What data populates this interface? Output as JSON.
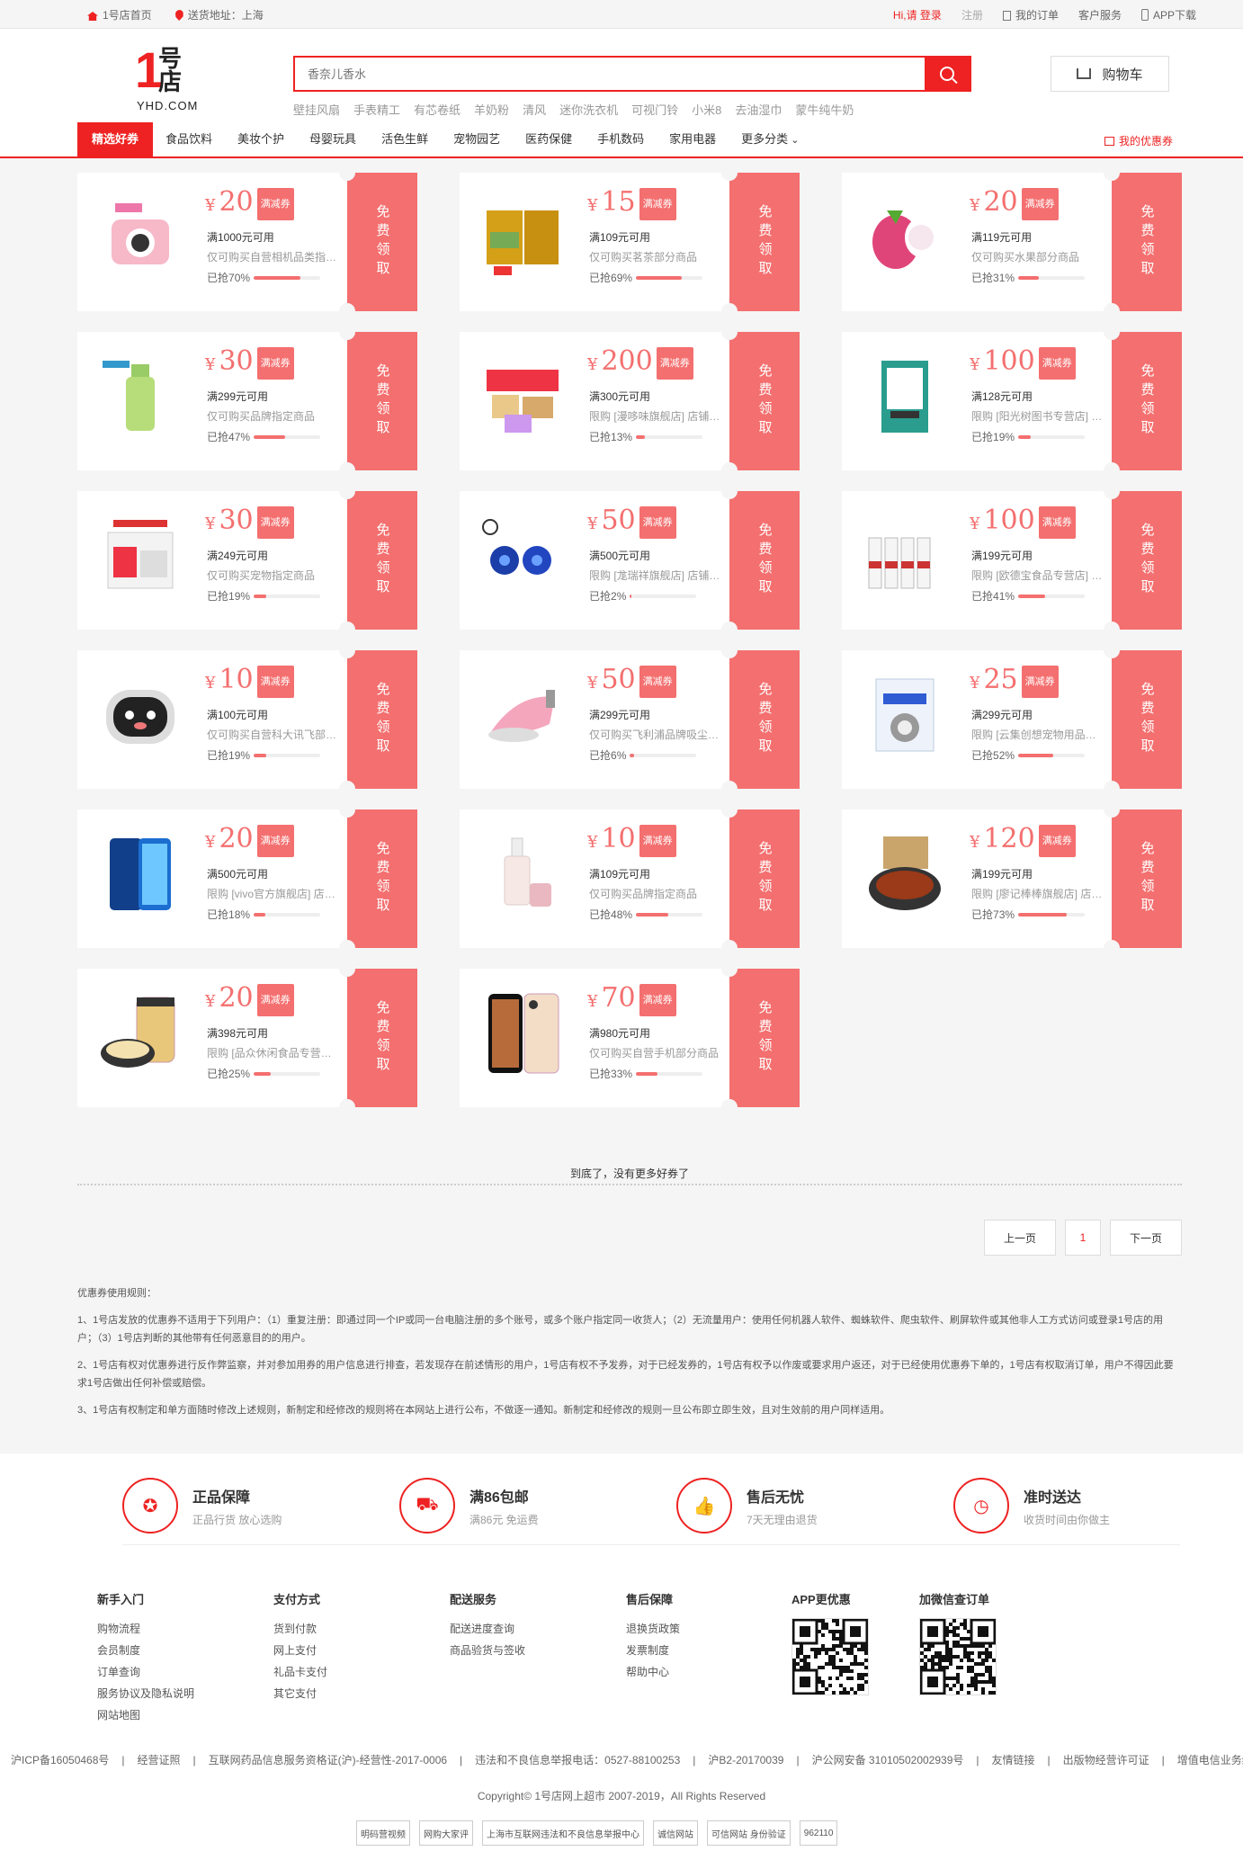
{
  "topbar": {
    "home": "1号店首页",
    "ship_label": "送货地址：上海",
    "hi": "Hi,请",
    "login": "登录",
    "register": "注册",
    "orders": "我的订单",
    "service": "客户服务",
    "app": "APP下载"
  },
  "header": {
    "logo_cn": "1号店",
    "logo_com": "YHD.COM",
    "search_placeholder": "香奈儿香水",
    "cart_label": "购物车",
    "hot_words": [
      "壁挂风扇",
      "手表精工",
      "有芯卷纸",
      "羊奶粉",
      "清风",
      "迷你洗衣机",
      "可视门铃",
      "小米8",
      "去油湿巾",
      "蒙牛纯牛奶"
    ]
  },
  "nav": {
    "items": [
      "精选好券",
      "食品饮料",
      "美妆个护",
      "母婴玩具",
      "活色生鲜",
      "宠物园艺",
      "医药保健",
      "手机数码",
      "家用电器",
      "更多分类"
    ],
    "my_coupon": "我的优惠券"
  },
  "coupon_common": {
    "currency": "¥",
    "tag": "满减券",
    "claim": "免费领取",
    "sold_prefix": "已抢"
  },
  "coupons": [
    {
      "amount": "20",
      "cond": "满1000元可用",
      "scope": "仅可购买自营相机品类指定商品",
      "sold": "70%",
      "product": "camera"
    },
    {
      "amount": "15",
      "cond": "满109元可用",
      "scope": "仅可购买茗茶部分商品",
      "sold": "69%",
      "product": "tea"
    },
    {
      "amount": "20",
      "cond": "满119元可用",
      "scope": "仅可购买水果部分商品",
      "sold": "31%",
      "product": "fruit"
    },
    {
      "amount": "30",
      "cond": "满299元可用",
      "scope": "仅可购买品牌指定商品",
      "sold": "47%",
      "product": "serum"
    },
    {
      "amount": "200",
      "cond": "满300元可用",
      "scope": "限购 [漫哆味旗舰店] 店铺商品",
      "sold": "13%",
      "product": "snack"
    },
    {
      "amount": "100",
      "cond": "满128元可用",
      "scope": "限购 [阳光树图书专营店] 店铺商品",
      "sold": "19%",
      "product": "book"
    },
    {
      "amount": "30",
      "cond": "满249元可用",
      "scope": "仅可购买宠物指定商品",
      "sold": "19%",
      "product": "petfood"
    },
    {
      "amount": "50",
      "cond": "满500元可用",
      "scope": "限购 [尨瑞祥旗舰店] 店铺商品",
      "sold": "2%",
      "product": "earphone"
    },
    {
      "amount": "100",
      "cond": "满199元可用",
      "scope": "限购 [欧德宝食品专营店] 店铺商品",
      "sold": "41%",
      "product": "milk"
    },
    {
      "amount": "10",
      "cond": "满100元可用",
      "scope": "仅可购买自营科大讯飞部分商品",
      "sold": "19%",
      "product": "robot"
    },
    {
      "amount": "50",
      "cond": "满299元可用",
      "scope": "仅可购买飞利浦品牌吸尘器商品",
      "sold": "6%",
      "product": "vacuum"
    },
    {
      "amount": "25",
      "cond": "满299元可用",
      "scope": "限购 [云集创想宠物用品专营店]",
      "sold": "52%",
      "product": "catlitter"
    },
    {
      "amount": "20",
      "cond": "满500元可用",
      "scope": "限购 [vivo官方旗舰店] 店铺商品",
      "sold": "18%",
      "product": "phone"
    },
    {
      "amount": "10",
      "cond": "满109元可用",
      "scope": "仅可购买品牌指定商品",
      "sold": "48%",
      "product": "lotion"
    },
    {
      "amount": "120",
      "cond": "满199元可用",
      "scope": "限购 [廖记棒棒旗舰店] 店铺商品",
      "sold": "73%",
      "product": "duck"
    },
    {
      "amount": "20",
      "cond": "满398元可用",
      "scope": "限购 [品众休闲食品专营店] 店铺商品",
      "sold": "25%",
      "product": "jar"
    },
    {
      "amount": "70",
      "cond": "满980元可用",
      "scope": "仅可购买自营手机部分商品",
      "sold": "33%",
      "product": "iphone"
    }
  ],
  "end_text": "到底了，没有更多好券了",
  "pager": {
    "prev": "上一页",
    "current": "1",
    "next": "下一页"
  },
  "rules": {
    "title": "优惠券使用规则：",
    "r1": "1、1号店发放的优惠券不适用于下列用户：（1）重复注册：即通过同一个IP或同一台电脑注册的多个账号，或多个账户指定同一收货人；（2）无流量用户：使用任何机器人软件、蜘蛛软件、爬虫软件、刷屏软件或其他非人工方式访问或登录1号店的用户；（3）1号店判断的其他带有任何恶意目的的用户。",
    "r2": "2、1号店有权对优惠券进行反作弊监察，并对参加用券的用户信息进行排查，若发现存在前述情形的用户，1号店有权不予发券，对于已经发券的，1号店有权予以作废或要求用户返还，对于已经使用优惠券下单的，1号店有权取消订单，用户不得因此要求1号店做出任何补偿或赔偿。",
    "r3": "3、1号店有权制定和单方面随时修改上述规则，新制定和经修改的规则将在本网站上进行公布，不做逐一通知。新制定和经修改的规则一旦公布即立即生效，且对生效前的用户同样适用。"
  },
  "guarantees": [
    {
      "title": "正品保障",
      "sub": "正品行货 放心选购",
      "icon": "medal-icon"
    },
    {
      "title": "满86包邮",
      "sub": "满86元 免运费",
      "icon": "truck-icon"
    },
    {
      "title": "售后无忧",
      "sub": "7天无理由退货",
      "icon": "thumb-icon"
    },
    {
      "title": "准时送达",
      "sub": "收货时间由你做主",
      "icon": "clock-icon"
    }
  ],
  "footer_cols": [
    {
      "title": "新手入门",
      "links": [
        "购物流程",
        "会员制度",
        "订单查询",
        "服务协议及隐私说明",
        "网站地图"
      ]
    },
    {
      "title": "支付方式",
      "links": [
        "货到付款",
        "网上支付",
        "礼品卡支付",
        "其它支付"
      ]
    },
    {
      "title": "配送服务",
      "links": [
        "配送进度查询",
        "商品验货与签收"
      ]
    },
    {
      "title": "售后保障",
      "links": [
        "退换货政策",
        "发票制度",
        "帮助中心"
      ]
    }
  ],
  "qr": {
    "app": "APP更优惠",
    "wechat": "加微信查订单"
  },
  "beian": [
    "沪ICP备16050468号",
    "|",
    "经营证照",
    "|",
    "互联网药品信息服务资格证(沪)-经营性-2017-0006",
    "|",
    "违法和不良信息举报电话：0527-88100253",
    "|",
    "沪B2-20170039",
    "|",
    "沪公网安备 31010502002939号",
    "|",
    "友情链接",
    "|",
    "出版物经营许可证",
    "|",
    "增值电信业务经营许可证"
  ],
  "copyright": "Copyright© 1号店网上超市 2007-2019，All Rights Reserved",
  "badges": [
    "明码营视频",
    "网购大家评",
    "上海市互联网违法和不良信息举报中心",
    "诚信网站",
    "可信网站 身份验证",
    "962110"
  ],
  "colors": {
    "accent": "#e22222",
    "coupon": "#f46f6f",
    "bg": "#f5f5f5"
  }
}
